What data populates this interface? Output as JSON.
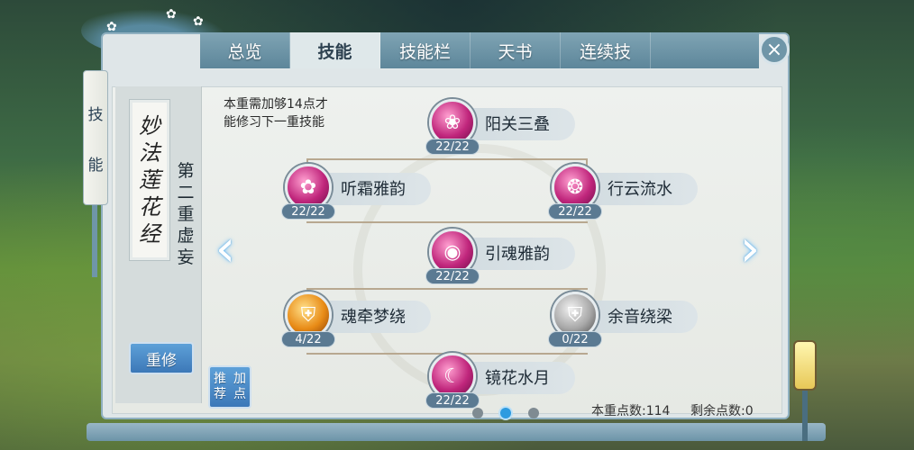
{
  "tabs": [
    {
      "label": "总览",
      "active": false
    },
    {
      "label": "技能",
      "active": true
    },
    {
      "label": "技能栏",
      "active": false
    },
    {
      "label": "天书",
      "active": false
    },
    {
      "label": "连续技",
      "active": false
    }
  ],
  "close_label": "×",
  "scroll_tag": {
    "chars": [
      "技",
      "能"
    ]
  },
  "title_card": {
    "chars": [
      "妙",
      "法",
      "莲",
      "花",
      "经"
    ]
  },
  "layer_label": {
    "chars": [
      "第",
      "二",
      "重",
      "虚",
      "妄"
    ]
  },
  "requirement_text": [
    "本重需加够14点才",
    "能修习下一重技能"
  ],
  "buttons": {
    "redo": "重修",
    "recommend": [
      "推荐",
      "加点"
    ]
  },
  "nav": {
    "prev": "‹",
    "next": "›"
  },
  "skills": [
    {
      "name": "阳关三叠",
      "level": "22/22",
      "icon": "pink-ribbon-icon"
    },
    {
      "name": "听霜雅韵",
      "level": "22/22",
      "icon": "pink-flower-icon"
    },
    {
      "name": "行云流水",
      "level": "22/22",
      "icon": "pink-swirl-icon"
    },
    {
      "name": "引魂雅韵",
      "level": "22/22",
      "icon": "pink-orb-icon"
    },
    {
      "name": "魂牵梦绕",
      "level": "4/22",
      "icon": "orange-shield-icon"
    },
    {
      "name": "余音绕梁",
      "level": "0/22",
      "icon": "grey-shield-icon"
    },
    {
      "name": "镜花水月",
      "level": "22/22",
      "icon": "pink-moon-icon"
    }
  ],
  "pagination": {
    "pages": 3,
    "active": 2
  },
  "points": {
    "layer_label": "本重点数:",
    "layer_value": "114",
    "remaining_label": "剩余点数:",
    "remaining_value": "0"
  },
  "colors": {
    "accent": "#2e9be0",
    "tab_bar": "#6f96a8",
    "skill_pink": "#c0267c"
  }
}
